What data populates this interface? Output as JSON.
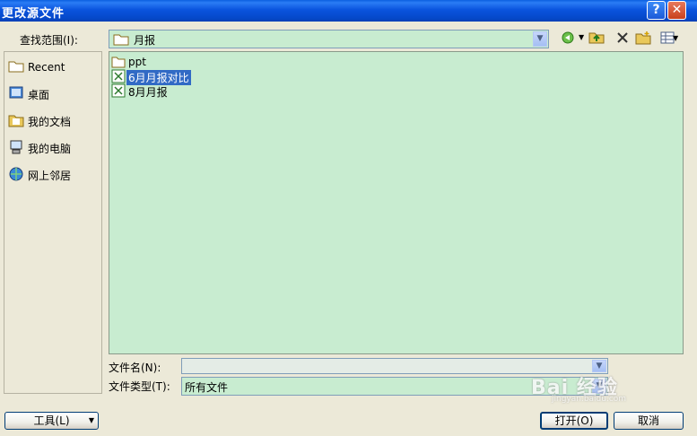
{
  "window": {
    "title": "更改源文件",
    "help_glyph": "?",
    "close_glyph": "✕"
  },
  "lookin": {
    "label": "查找范围(I):",
    "value": "月报"
  },
  "places": [
    {
      "label": "Recent",
      "icon": "recent-folder-icon"
    },
    {
      "label": "桌面",
      "icon": "desktop-icon"
    },
    {
      "label": "我的文档",
      "icon": "my-documents-icon"
    },
    {
      "label": "我的电脑",
      "icon": "my-computer-icon"
    },
    {
      "label": "网上邻居",
      "icon": "network-places-icon"
    }
  ],
  "files": [
    {
      "label": "ppt",
      "icon": "folder-icon",
      "selected": false
    },
    {
      "label": "6月月报对比",
      "icon": "excel-file-icon",
      "selected": true
    },
    {
      "label": "8月月报",
      "icon": "excel-file-icon",
      "selected": false
    }
  ],
  "filename": {
    "label": "文件名(N):",
    "value": ""
  },
  "filetype": {
    "label": "文件类型(T):",
    "value": "所有文件"
  },
  "buttons": {
    "tools": "工具(L)",
    "open": "打开(O)",
    "cancel": "取消"
  },
  "watermark": {
    "text": "Bai 经验",
    "sub": "jingyan.baidu.com"
  },
  "colors": {
    "file_area": "#c8ecd0",
    "selection": "#316ac5",
    "titlebar": "#0a54de"
  }
}
